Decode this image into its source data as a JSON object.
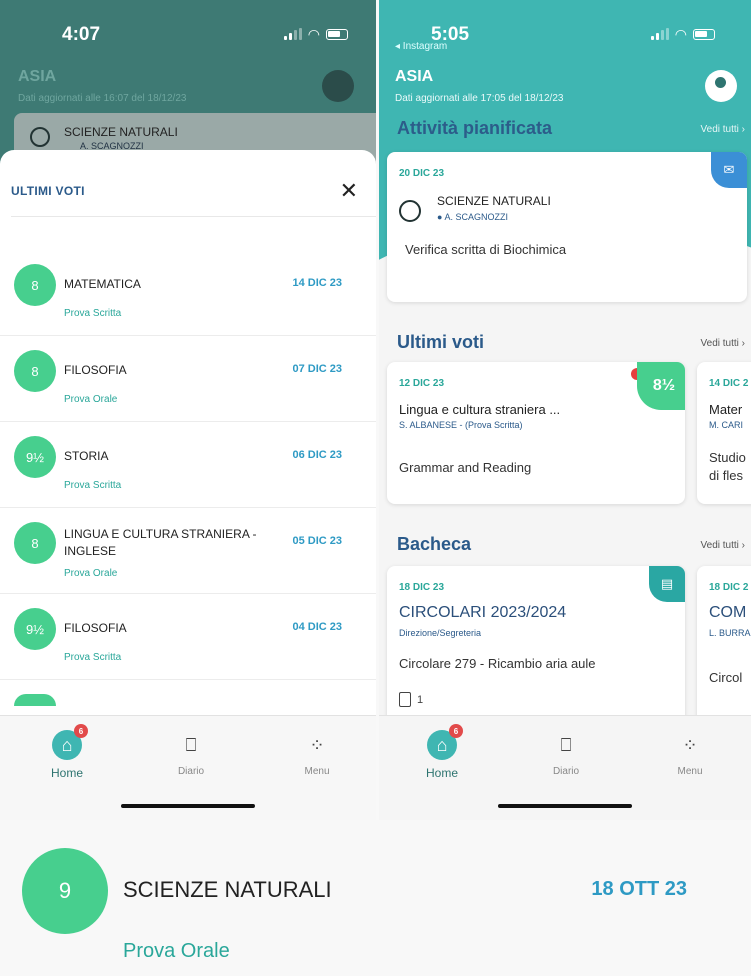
{
  "left": {
    "time": "4:07",
    "school": "ASIA",
    "updated": "Dati aggiornati alle 16:07 del 18/12/23",
    "peek_title": "SCIENZE NATURALI",
    "peek_teacher": "A. SCAGNOZZI",
    "modal_title": "ULTIMI VOTI",
    "close": "✕",
    "grades": [
      {
        "grade": "8",
        "subject": "MATEMATICA",
        "type": "Prova Scritta",
        "date": "14 DIC 23"
      },
      {
        "grade": "8",
        "subject": "FILOSOFIA",
        "type": "Prova Orale",
        "date": "07 DIC 23"
      },
      {
        "grade": "9½",
        "subject": "STORIA",
        "type": "Prova Scritta",
        "date": "06 DIC 23"
      },
      {
        "grade": "8",
        "subject": "LINGUA E CULTURA STRANIERA - INGLESE",
        "type": "Prova Orale",
        "date": "05 DIC 23"
      },
      {
        "grade": "9½",
        "subject": "FILOSOFIA",
        "type": "Prova Scritta",
        "date": "04 DIC 23"
      }
    ]
  },
  "right": {
    "time": "5:05",
    "back": "◂ Instagram",
    "school": "ASIA",
    "updated": "Dati aggiornati alle 17:05 del 18/12/23",
    "planned": {
      "title": "Attività pianificata",
      "see_all": "Vedi tutti ›",
      "date": "20 DIC 23",
      "subject": "SCIENZE NATURALI",
      "teacher": "A. SCAGNOZZI",
      "desc": "Verifica scritta di Biochimica"
    },
    "grades": {
      "title": "Ultimi voti",
      "see_all": "Vedi tutti ›",
      "card1": {
        "date": "12 DIC 23",
        "subject": "Lingua e cultura straniera ...",
        "teacher": "S. ALBANESE - (Prova Scritta)",
        "desc": "Grammar and Reading",
        "grade": "8½"
      },
      "card2": {
        "date": "14 DIC 2",
        "subject": "Mater",
        "teacher": "M. CARI",
        "desc1": "Studio",
        "desc2": "di fles"
      }
    },
    "board": {
      "title": "Bacheca",
      "see_all": "Vedi tutti ›",
      "card1": {
        "date": "18 DIC 23",
        "title": "CIRCOLARI 2023/2024",
        "author": "Direzione/Segreteria",
        "desc": "Circolare 279 - Ricambio aria aule",
        "attachments": "1"
      },
      "card2": {
        "date": "18 DIC 2",
        "title": "COM",
        "author": "L. BURRA",
        "desc": "Circol"
      }
    }
  },
  "nav": {
    "home": "Home",
    "diary": "Diario",
    "menu": "Menu",
    "badge": "6"
  },
  "detail": {
    "grade": "9",
    "subject": "SCIENZE NATURALI",
    "type": "Prova Orale",
    "date": "18 OTT 23"
  }
}
